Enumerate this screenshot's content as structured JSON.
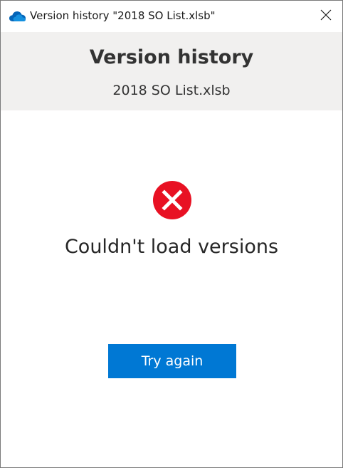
{
  "window": {
    "title": "Version history \"2018 SO List.xlsb\"",
    "app_icon": "onedrive-cloud-icon",
    "close_icon": "close-icon"
  },
  "header": {
    "title": "Version history",
    "subtitle": "2018 SO List.xlsb"
  },
  "error": {
    "icon": "error-x-icon",
    "message": "Couldn't load versions"
  },
  "actions": {
    "try_again_label": "Try again"
  },
  "colors": {
    "accent": "#0078d4",
    "error": "#e81123",
    "header_bg": "#f1f0ef",
    "cloud": "#0364b8"
  }
}
